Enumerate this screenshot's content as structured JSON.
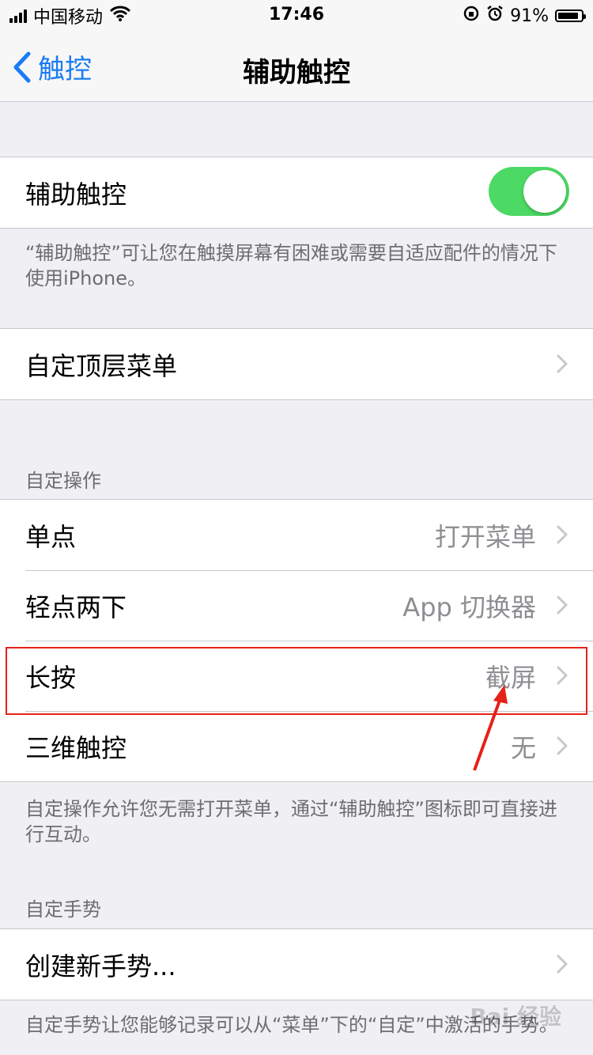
{
  "status": {
    "carrier": "中国移动",
    "time": "17:46",
    "battery": "91%",
    "battery_level": 0.91,
    "icons": [
      "signal-icon",
      "wifi-icon",
      "rotation-lock-icon",
      "alarm-icon",
      "battery-icon"
    ]
  },
  "nav": {
    "back_label": "触控",
    "title": "辅助触控"
  },
  "assistive_touch": {
    "label": "辅助触控",
    "enabled": true,
    "footer": "“辅助触控”可让您在触摸屏幕有困难或需要自适应配件的情况下使用iPhone。"
  },
  "top_menu": {
    "label": "自定顶层菜单"
  },
  "custom_actions": {
    "header": "自定操作",
    "rows": [
      {
        "label": "单点",
        "value": "打开菜单"
      },
      {
        "label": "轻点两下",
        "value": "App 切换器"
      },
      {
        "label": "长按",
        "value": "截屏"
      },
      {
        "label": "三维触控",
        "value": "无"
      }
    ],
    "footer": "自定操作允许您无需打开菜单，通过“辅助触控”图标即可直接进行互动。"
  },
  "custom_gestures": {
    "header": "自定手势",
    "create_label": "创建新手势...",
    "footer": "自定手势让您能够记录可以从“菜单”下的“自定”中激活的手势。"
  },
  "colors": {
    "accent": "#1a7cf5",
    "toggle_on": "#4cd964",
    "annotation": "#e62117"
  },
  "watermark": "Bai 经验"
}
